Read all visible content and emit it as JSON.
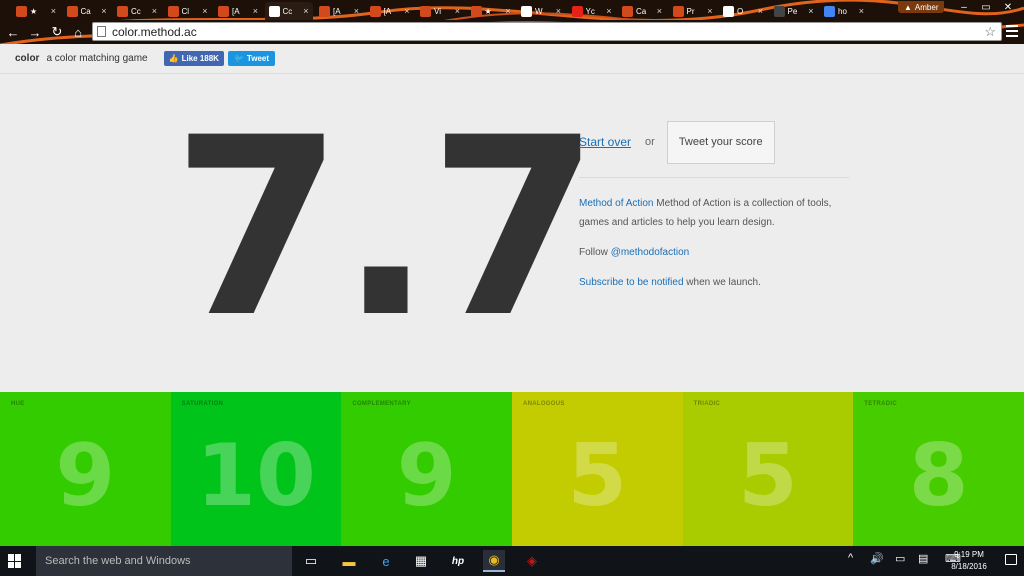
{
  "browser": {
    "tabs": [
      {
        "title": "★",
        "color": "#d24a1c"
      },
      {
        "title": "Ca",
        "color": "#d24a1c"
      },
      {
        "title": "Cc",
        "color": "#d24a1c"
      },
      {
        "title": "Cl",
        "color": "#d24a1c"
      },
      {
        "title": "[A",
        "color": "#d24a1c"
      },
      {
        "title": "Cc",
        "color": "#ffffff"
      },
      {
        "title": "[A",
        "color": "#d24a1c"
      },
      {
        "title": "[A",
        "color": "#d24a1c"
      },
      {
        "title": "Vi",
        "color": "#d24a1c"
      },
      {
        "title": "★",
        "color": "#d24a1c"
      },
      {
        "title": "W",
        "color": "#ffffff"
      },
      {
        "title": "Yc",
        "color": "#e62117"
      },
      {
        "title": "Ca",
        "color": "#d24a1c"
      },
      {
        "title": "Pr",
        "color": "#d24a1c"
      },
      {
        "title": "O",
        "color": "#ffffff"
      },
      {
        "title": "Pe",
        "color": "#444444"
      },
      {
        "title": "ho",
        "color": "#4285f4"
      }
    ],
    "active_tab_index": 5,
    "profile_name": "Amber",
    "url": "color.method.ac"
  },
  "site": {
    "brand": "color",
    "tagline": "a color matching game",
    "like_label": "Like 188K",
    "tweet_label": "Tweet"
  },
  "result": {
    "score": "7.7",
    "start_over": "Start over",
    "or": "or",
    "tweet_score": "Tweet your score",
    "about_link": "Method of Action",
    "about_text": " Method of Action is a collection of tools, games and articles to help you learn design.",
    "follow_prefix": "Follow ",
    "follow_handle": "@methodofaction",
    "subscribe_link": "Subscribe to be notified",
    "subscribe_text": " when we launch."
  },
  "categories": [
    {
      "label": "HUE",
      "value": "9",
      "color": "#33cc00"
    },
    {
      "label": "SATURATION",
      "value": "10",
      "color": "#00c41a"
    },
    {
      "label": "COMPLEMENTARY",
      "value": "9",
      "color": "#33cc00"
    },
    {
      "label": "ANALOGOUS",
      "value": "5",
      "color": "#c2cc00"
    },
    {
      "label": "TRIADIC",
      "value": "5",
      "color": "#a8cc00"
    },
    {
      "label": "TETRADIC",
      "value": "8",
      "color": "#47cc00"
    }
  ],
  "taskbar": {
    "search_placeholder": "Search the web and Windows",
    "time": "9:19 PM",
    "date": "8/18/2016"
  }
}
